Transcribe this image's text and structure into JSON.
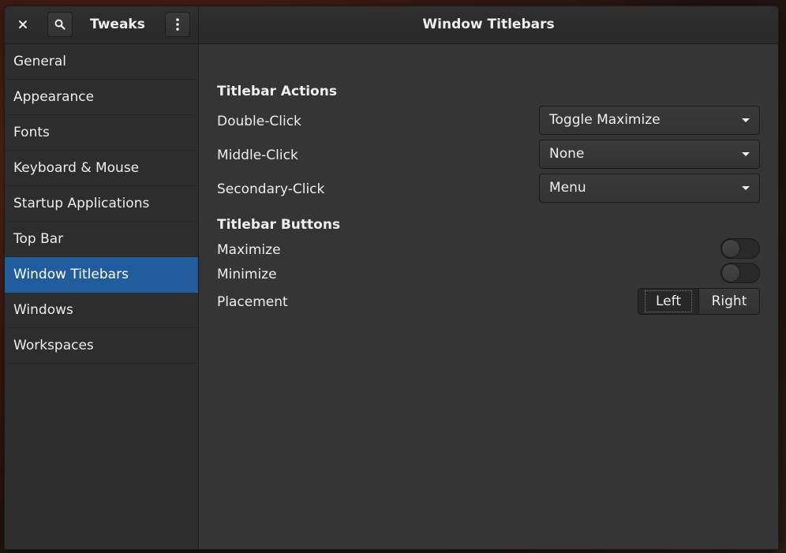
{
  "app": {
    "title": "Tweaks",
    "panel_title": "Window Titlebars"
  },
  "icons": {
    "close": "close-icon",
    "search": "search-icon",
    "menu": "vertical-dots-icon",
    "dropdown": "chevron-down-icon"
  },
  "colors": {
    "accent": "#215d9c",
    "background": "#353535",
    "sidebar": "#2d2d2d",
    "text": "#eeeeec"
  },
  "sidebar": {
    "items": [
      {
        "label": "General",
        "selected": false
      },
      {
        "label": "Appearance",
        "selected": false
      },
      {
        "label": "Fonts",
        "selected": false
      },
      {
        "label": "Keyboard & Mouse",
        "selected": false
      },
      {
        "label": "Startup Applications",
        "selected": false
      },
      {
        "label": "Top Bar",
        "selected": false
      },
      {
        "label": "Window Titlebars",
        "selected": true
      },
      {
        "label": "Windows",
        "selected": false
      },
      {
        "label": "Workspaces",
        "selected": false
      }
    ]
  },
  "main": {
    "actions": {
      "title": "Titlebar Actions",
      "double_click": {
        "label": "Double-Click",
        "value": "Toggle Maximize"
      },
      "middle_click": {
        "label": "Middle-Click",
        "value": "None"
      },
      "secondary_click": {
        "label": "Secondary-Click",
        "value": "Menu"
      }
    },
    "buttons": {
      "title": "Titlebar Buttons",
      "maximize": {
        "label": "Maximize",
        "on": false
      },
      "minimize": {
        "label": "Minimize",
        "on": false
      },
      "placement": {
        "label": "Placement",
        "options": [
          "Left",
          "Right"
        ],
        "selected": "Left"
      }
    }
  }
}
